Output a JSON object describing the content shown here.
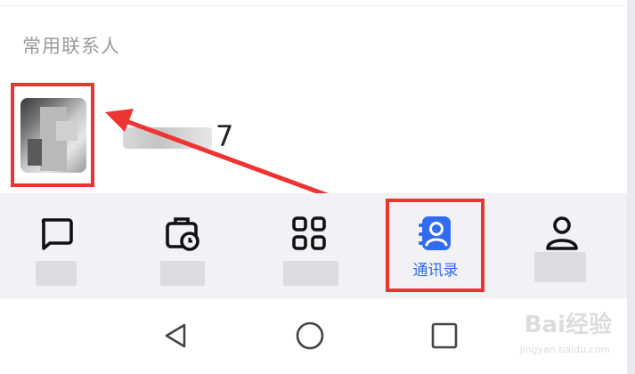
{
  "section": {
    "title": "常用联系人"
  },
  "contacts": [
    {
      "name_suffix": "7"
    }
  ],
  "tabs": [
    {
      "id": "messages",
      "icon": "chat-bubble-icon",
      "label": ""
    },
    {
      "id": "calendar",
      "icon": "calendar-clock-icon",
      "label": ""
    },
    {
      "id": "apps",
      "icon": "grid-icon",
      "label": ""
    },
    {
      "id": "contacts",
      "icon": "contacts-book-icon",
      "label": "通讯录",
      "active": true
    },
    {
      "id": "me",
      "icon": "person-icon",
      "label": ""
    }
  ],
  "system_nav": [
    {
      "id": "back",
      "icon": "triangle-back-icon"
    },
    {
      "id": "home",
      "icon": "circle-home-icon"
    },
    {
      "id": "recents",
      "icon": "square-recents-icon"
    }
  ],
  "watermark": {
    "brand": "Bai经验",
    "sub": "jingyan.baidu.com"
  },
  "colors": {
    "accent": "#2f6cf0",
    "annotation": "#ee3333",
    "tabbar_bg": "#f1f1f6"
  }
}
